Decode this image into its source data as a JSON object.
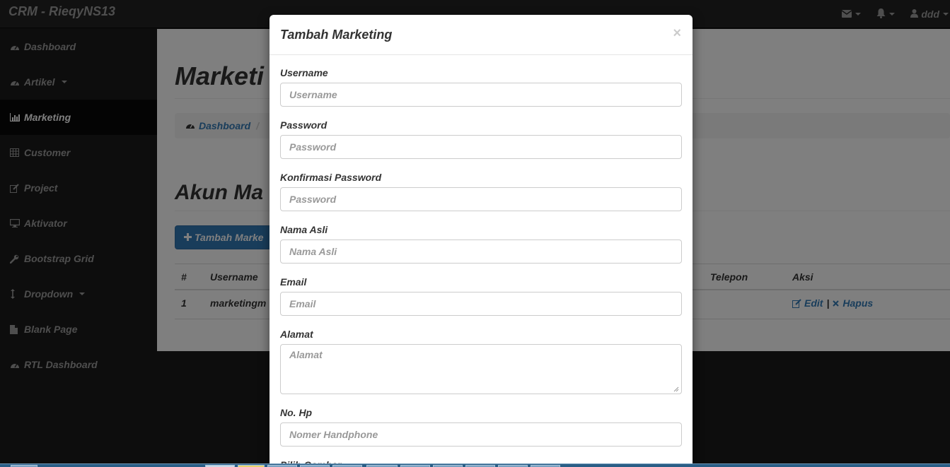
{
  "navbar": {
    "brand": "CRM - RieqyNS13",
    "user_name": "ddd",
    "icons": [
      "envelope-icon",
      "bell-icon",
      "user-icon"
    ]
  },
  "sidebar": {
    "items": [
      {
        "label": "Dashboard",
        "icon": "dashboard-icon"
      },
      {
        "label": "Artikel",
        "icon": "dashboard-icon",
        "dropdown": true
      },
      {
        "label": "Marketing",
        "icon": "bar-chart-icon",
        "active": true
      },
      {
        "label": "Customer",
        "icon": "table-icon"
      },
      {
        "label": "Project",
        "icon": "edit-icon"
      },
      {
        "label": "Aktivator",
        "icon": "desktop-icon"
      },
      {
        "label": "Bootstrap Grid",
        "icon": "wrench-icon"
      },
      {
        "label": "Dropdown",
        "icon": "arrows-v-icon",
        "dropdown": true
      },
      {
        "label": "Blank Page",
        "icon": "file-icon"
      },
      {
        "label": "RTL Dashboard",
        "icon": "dashboard-icon"
      }
    ]
  },
  "page": {
    "title": "Marketi",
    "breadcrumb": {
      "home": "Dashboard",
      "separator": "/"
    },
    "section_title": "Akun Ma",
    "add_button": "Tambah Marke",
    "table": {
      "headers": {
        "no": "#",
        "username": "Username",
        "telepon": "Telepon",
        "aksi": "Aksi"
      },
      "rows": [
        {
          "no": "1",
          "username": "marketingm"
        }
      ],
      "edit_label": "Edit",
      "action_separator": "|",
      "delete_label": "Hapus"
    }
  },
  "modal": {
    "title": "Tambah Marketing",
    "close": "×",
    "fields": [
      {
        "label": "Username",
        "placeholder": "Username"
      },
      {
        "label": "Password",
        "placeholder": "Password"
      },
      {
        "label": "Konfirmasi Password",
        "placeholder": "Password"
      },
      {
        "label": "Nama Asli",
        "placeholder": "Nama Asli"
      },
      {
        "label": "Email",
        "placeholder": "Email"
      },
      {
        "label": "Alamat",
        "placeholder": "Alamat"
      },
      {
        "label": "No. Hp",
        "placeholder": "Nomer Handphone"
      },
      {
        "label": "Pilih Gambar"
      }
    ]
  },
  "colors": {
    "navbar_bg": "#222222",
    "sidebar_active_bg": "#080808",
    "link": "#337ab7",
    "primary_button": "#337ab7"
  }
}
